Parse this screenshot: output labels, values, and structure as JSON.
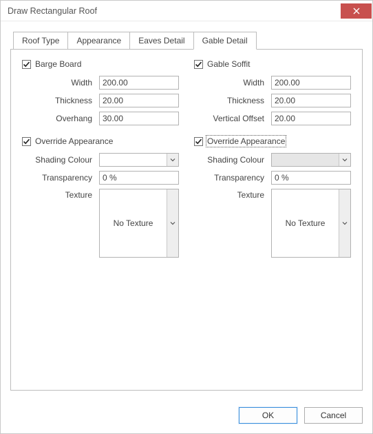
{
  "window": {
    "title": "Draw Rectangular Roof"
  },
  "tabs": {
    "roof_type": "Roof Type",
    "appearance": "Appearance",
    "eaves_detail": "Eaves Detail",
    "gable_detail": "Gable Detail"
  },
  "left": {
    "section": "Barge Board",
    "width_label": "Width",
    "width_value": "200.00",
    "thickness_label": "Thickness",
    "thickness_value": "20.00",
    "overhang_label": "Overhang",
    "overhang_value": "30.00",
    "override_label": "Override Appearance",
    "shading_label": "Shading Colour",
    "transparency_label": "Transparency",
    "transparency_value": "0 %",
    "texture_label": "Texture",
    "texture_value": "No Texture"
  },
  "right": {
    "section": "Gable Soffit",
    "width_label": "Width",
    "width_value": "200.00",
    "thickness_label": "Thickness",
    "thickness_value": "20.00",
    "voffset_label": "Vertical Offset",
    "voffset_value": "20.00",
    "override_label": "Override Appearance",
    "shading_label": "Shading Colour",
    "transparency_label": "Transparency",
    "transparency_value": "0 %",
    "texture_label": "Texture",
    "texture_value": "No Texture"
  },
  "buttons": {
    "ok": "OK",
    "cancel": "Cancel"
  }
}
